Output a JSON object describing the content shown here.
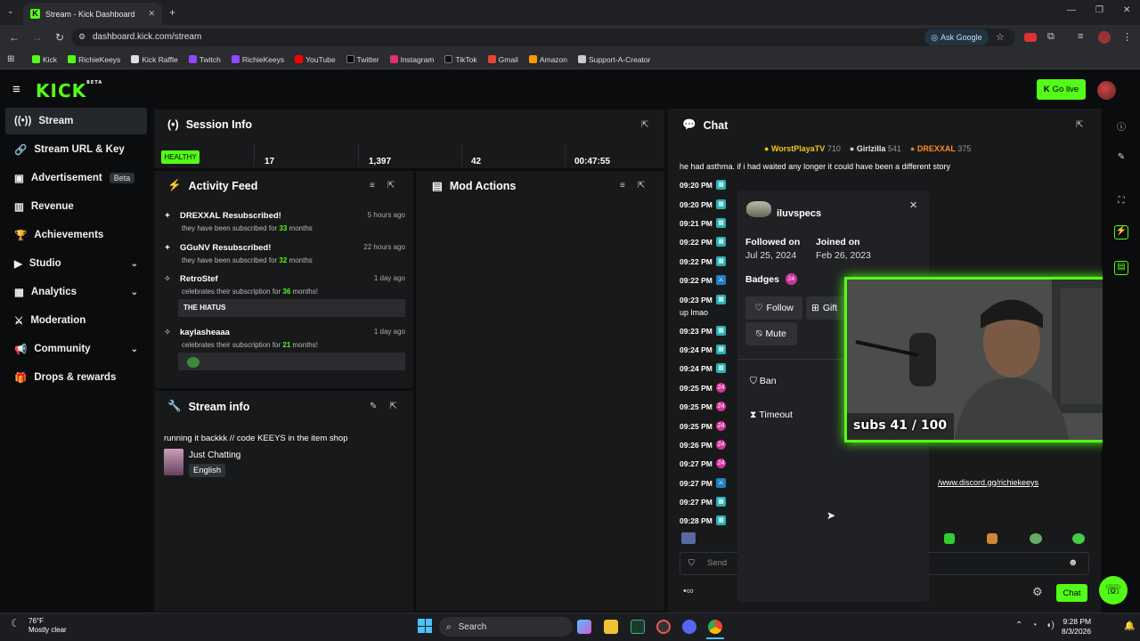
{
  "browser": {
    "tab_title": "Stream - Kick Dashboard",
    "url": "dashboard.kick.com/stream",
    "ask_google": "Ask Google",
    "bookmarks": [
      "Kick",
      "RichieKeeys",
      "Kick Raffle",
      "Twitch",
      "RichieKeeys",
      "YouTube",
      "Twitter",
      "Instagram",
      "TikTok",
      "Gmail",
      "Amazon",
      "Support-A-Creator"
    ]
  },
  "header": {
    "logo": "KICK",
    "logo_sup": "BETA",
    "go_live": "Go live"
  },
  "sidebar": {
    "items": [
      {
        "label": "Stream",
        "icon": "stream-icon"
      },
      {
        "label": "Stream URL & Key",
        "icon": "link-icon"
      },
      {
        "label": "Advertisement",
        "icon": "ad-icon",
        "badge": "Beta"
      },
      {
        "label": "Revenue",
        "icon": "chart-icon"
      },
      {
        "label": "Achievements",
        "icon": "trophy-icon"
      },
      {
        "label": "Studio",
        "icon": "camera-icon"
      },
      {
        "label": "Analytics",
        "icon": "analytics-icon"
      },
      {
        "label": "Moderation",
        "icon": "sword-icon"
      },
      {
        "label": "Community",
        "icon": "megaphone-icon"
      },
      {
        "label": "Drops & rewards",
        "icon": "gift-icon"
      }
    ]
  },
  "session": {
    "title": "Session Info",
    "status": "HEALTHY",
    "stats": [
      "17",
      "1,397",
      "42",
      "00:47:55"
    ]
  },
  "activity": {
    "title": "Activity Feed",
    "items": [
      {
        "name": "DREXXAL Resubscribed!",
        "sub_prefix": "they have been subscribed for ",
        "count": "33",
        "sub_suffix": " months",
        "time": "5 hours ago"
      },
      {
        "name": "GGuNV Resubscribed!",
        "sub_prefix": "they have been subscribed for ",
        "count": "32",
        "sub_suffix": " months",
        "time": "22 hours ago"
      },
      {
        "name": "RetroStef",
        "sub_prefix": "celebrates their subscription for ",
        "count": "36",
        "sub_suffix": " months!",
        "time": "1 day ago",
        "message": "THE HIATUS"
      },
      {
        "name": "kaylasheaaa",
        "sub_prefix": "celebrates their subscription for ",
        "count": "21",
        "sub_suffix": " months!",
        "time": "1 day ago",
        "message": ""
      }
    ]
  },
  "mod_actions": {
    "title": "Mod Actions"
  },
  "stream_info": {
    "title": "Stream info",
    "stream_title": "running it backkk // code KEEYS in the item shop",
    "category": "Just Chatting",
    "language": "English"
  },
  "chat": {
    "title": "Chat",
    "leaders": [
      {
        "name": "WorstPlayaTV",
        "points": "710"
      },
      {
        "name": "Girlzilla",
        "points": "541"
      },
      {
        "name": "DREXXAL",
        "points": "375"
      }
    ],
    "top_message": "he had asthma. if i had waited any longer it could have been a different story",
    "times": [
      "09:20 PM",
      "09:20 PM",
      "09:21 PM",
      "09:22 PM",
      "09:22 PM",
      "09:22 PM",
      "09:23 PM",
      "09:23 PM",
      "09:24 PM",
      "09:24 PM",
      "09:25 PM",
      "09:25 PM",
      "09:25 PM",
      "09:26 PM",
      "09:27 PM",
      "09:27 PM",
      "09:27 PM",
      "09:28 PM"
    ],
    "inline_text": "up lmao",
    "link_text": "/www.discord.gg/richiekeeys",
    "send_placeholder": "Send",
    "chat_button": "Chat"
  },
  "user_card": {
    "username": "iluvspecs",
    "followed_label": "Followed on",
    "followed_date": "Jul 25, 2024",
    "joined_label": "Joined on",
    "joined_date": "Feb 26, 2023",
    "badges_label": "Badges",
    "badge_value": "24",
    "follow": "Follow",
    "gift": "Gift",
    "mute": "Mute",
    "ban": "Ban",
    "timeout": "Timeout"
  },
  "webcam": {
    "overlay": "subs 41 / 100"
  },
  "taskbar": {
    "temp": "76°F",
    "weather": "Mostly clear",
    "search": "Search",
    "time": "9:28 PM",
    "date": "8/3/2026"
  }
}
